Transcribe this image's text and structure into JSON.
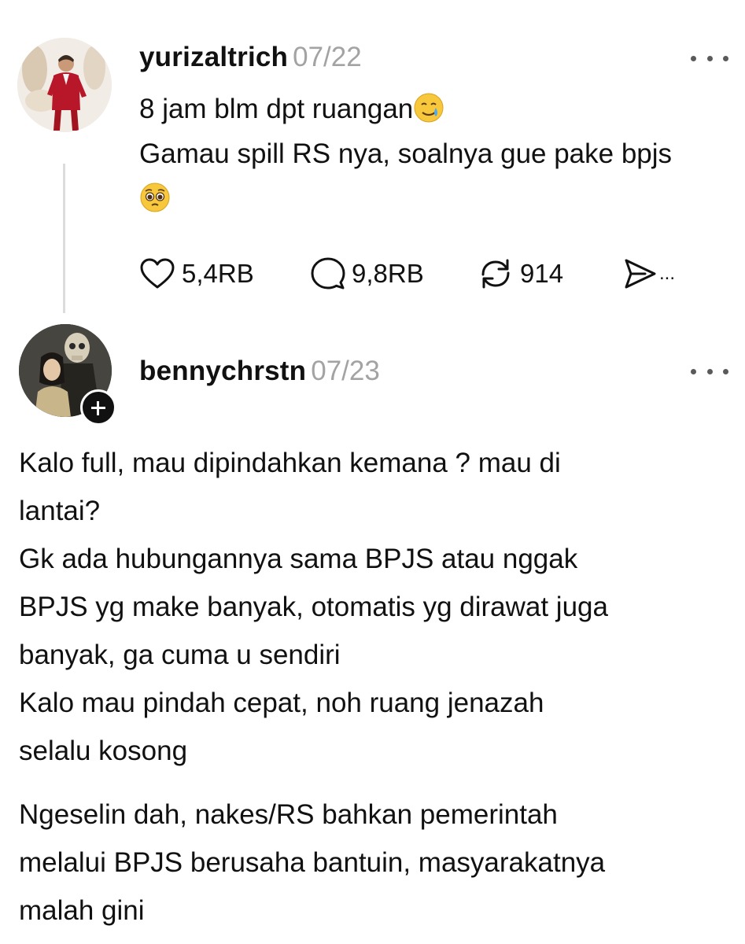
{
  "posts": [
    {
      "username": "yurizaltrich",
      "date": "07/22",
      "lines": [
        "8 jam blm dpt ruangan",
        "Gamau spill RS nya, soalnya gue pake bpjs"
      ],
      "emojis": [
        "smiling-face-with-tear",
        "pleading-face"
      ],
      "actions": {
        "likes": "5,4RB",
        "replies": "9,8RB",
        "reposts": "914",
        "share_more": "..."
      }
    },
    {
      "username": "bennychrstn",
      "date": "07/23",
      "paragraphs": [
        [
          "Kalo full, mau dipindahkan kemana ? mau di",
          "lantai?",
          "Gk ada hubungannya sama BPJS atau nggak",
          "BPJS yg make banyak, otomatis yg dirawat juga",
          "banyak, ga cuma u sendiri"
        ],
        [
          "Kalo mau pindah cepat, noh ruang jenazah",
          "selalu kosong"
        ],
        [
          "Ngeselin dah, nakes/RS bahkan pemerintah",
          "melalui BPJS berusaha bantuin, masyarakatnya",
          "malah gini"
        ]
      ]
    }
  ],
  "icons": {
    "like": "heart-icon",
    "reply": "comment-icon",
    "repost": "repost-icon",
    "share": "send-icon",
    "more": "more-options-icon",
    "follow": "plus-icon"
  }
}
